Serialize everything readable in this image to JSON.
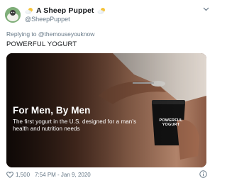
{
  "tweet": {
    "author": {
      "display_name": "A Sheep Puppet",
      "handle": "@SheepPuppet",
      "emoji_icon": "cloud-sun-emoji-icon",
      "avatar_icon": "avatar"
    },
    "reply_prefix": "Replying to",
    "reply_to": "@themouseyouknow",
    "text": "POWERFUL YOGURT",
    "media": {
      "headline": "For Men, By Men",
      "subline": "The first yogurt in the U.S. designed for a man's health and nutrition needs",
      "product_label": "POWERFUL YOGURT"
    },
    "stats": {
      "like_icon": "heart-icon",
      "like_count": "1,500",
      "timestamp": "7:54 PM - Jan 9, 2020"
    },
    "info_icon": "info-icon",
    "menu_icon": "chevron-down-icon"
  },
  "colors": {
    "primary_text": "#14171a",
    "secondary_text": "#657786",
    "background": "#ffffff"
  }
}
